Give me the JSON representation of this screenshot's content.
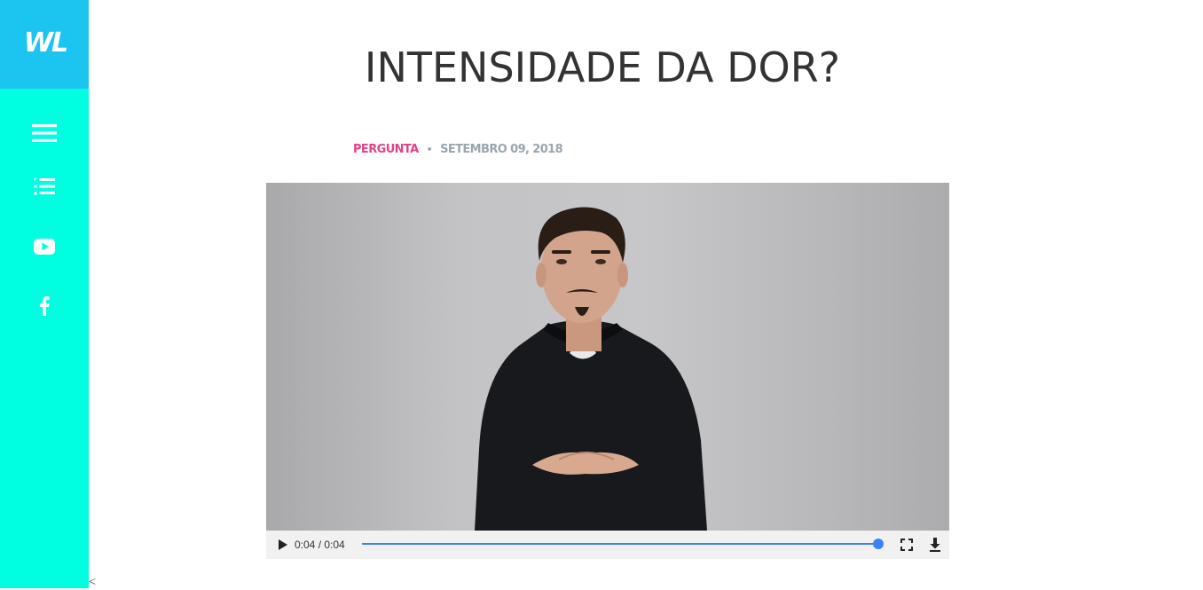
{
  "sidebar": {
    "logo": "WL",
    "items": [
      {
        "name": "menu",
        "icon": "hamburger-menu-icon"
      },
      {
        "name": "list",
        "icon": "numbered-list-icon"
      },
      {
        "name": "youtube",
        "icon": "youtube-icon"
      },
      {
        "name": "facebook",
        "icon": "facebook-icon"
      }
    ]
  },
  "post": {
    "title": "INTENSIDADE DA DOR?",
    "category": "PERGUNTA",
    "separator": "•",
    "date": "SETEMBRO 09, 2018"
  },
  "video": {
    "time": "0:04 / 0:04",
    "progress": 1.0,
    "controls": [
      "play-icon",
      "fullscreen-icon",
      "download-icon"
    ]
  },
  "stray_text": "<",
  "colors": {
    "sidebar_bg": "#00ffe0",
    "logo_bg": "#1cc5f0",
    "category": "#e2418a",
    "date": "#9aa5ad",
    "progress": "#3b82f6"
  }
}
